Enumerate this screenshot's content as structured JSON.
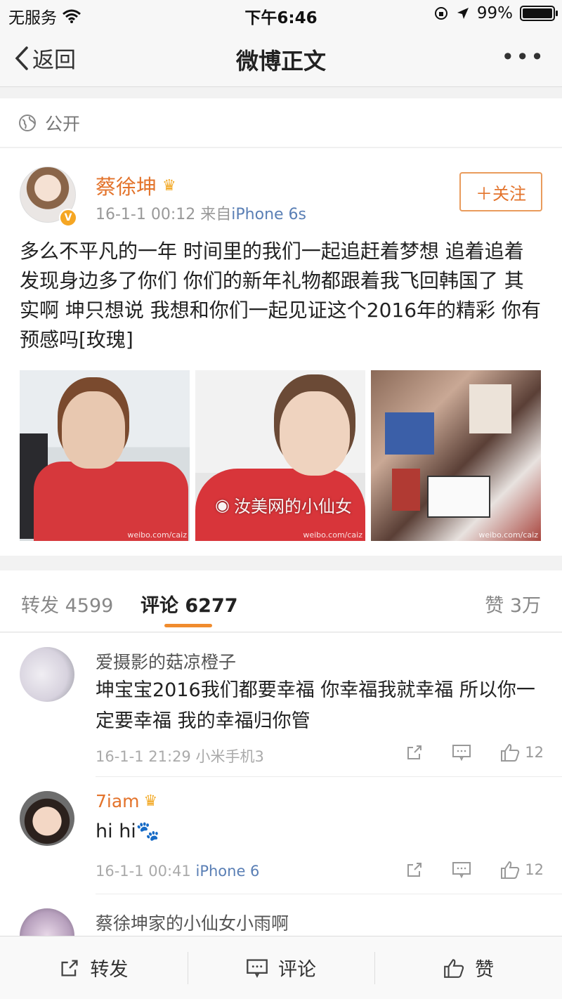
{
  "status_bar": {
    "carrier": "无服务",
    "time": "下午6:46",
    "battery": "99%",
    "battery_level": 0.99
  },
  "nav": {
    "back_label": "返回",
    "title": "微博正文",
    "more": "•••"
  },
  "visibility": {
    "label": "公开"
  },
  "post": {
    "author": "蔡徐坤",
    "verified_badge": "V",
    "date": "16-1-1 00:12",
    "source_prefix": "来自",
    "source": "iPhone 6s",
    "follow_label": "＋关注",
    "text": "多么不平凡的一年 时间里的我们一起追赶着梦想 追着追着发现身边多了你们 你们的新年礼物都跟着我飞回韩国了 其实啊 坤只想说 我想和你们一起见证这个2016年的精彩 你有预感吗[玫瑰]",
    "photo_watermark": "weibo.com/caiz",
    "overlay_watermark": "汝美网的小仙女"
  },
  "tabs": {
    "repost": "转发 4599",
    "comment": "评论 6277",
    "like": "赞 3万"
  },
  "comments": [
    {
      "name": "爱摄影的菇凉橙子",
      "text": "坤宝宝2016我们都要幸福 你幸福我就幸福 所以你一定要幸福 我的幸福归你管",
      "date": "16-1-1 21:29",
      "source": "小米手机3",
      "likes": "12"
    },
    {
      "name": "7iam",
      "text": "hi hi🐾",
      "date": "16-1-1 00:41",
      "source": "iPhone 6",
      "likes": "12"
    },
    {
      "name": "蔡徐坤家的小仙女小雨啊"
    }
  ],
  "bottom_bar": {
    "repost": "转发",
    "comment": "评论",
    "like": "赞"
  },
  "icons": {
    "wifi": "wifi-icon",
    "lock_rotation": "rotation-lock-icon",
    "location": "location-arrow-icon",
    "globe": "globe-icon",
    "crown": "crown-icon",
    "share": "share-icon",
    "comment": "comment-icon",
    "like": "thumbs-up-icon"
  },
  "colors": {
    "accent_orange": "#e3732b",
    "link_blue": "#5a7fb5",
    "tab_underline": "#f08c2e"
  }
}
